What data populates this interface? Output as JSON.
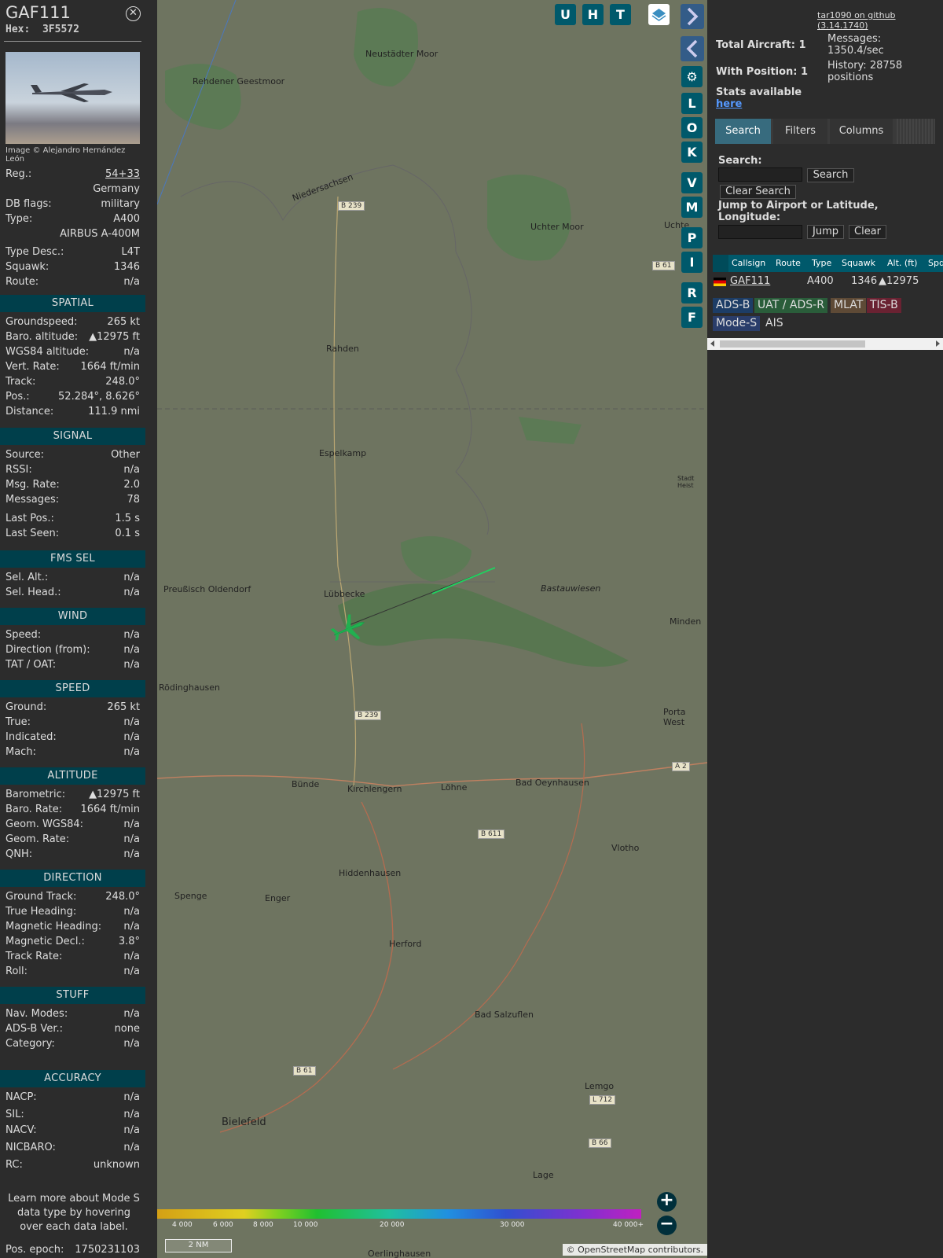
{
  "aircraft": {
    "callsign": "GAF111",
    "hex_label": "Hex:",
    "hex": "3F5572",
    "photo_credit": "Image © Alejandro Hernández León"
  },
  "details": [
    {
      "k": "Reg.:",
      "v": "54+33"
    },
    {
      "k": "",
      "v": "Germany"
    },
    {
      "k": "DB flags:",
      "v": "military"
    },
    {
      "k": "Type:",
      "v": "A400"
    },
    {
      "k": "",
      "v": "AIRBUS A-400M"
    },
    {
      "k": "Type Desc.:",
      "v": "L4T"
    },
    {
      "k": "Squawk:",
      "v": "1346"
    },
    {
      "k": "Route:",
      "v": "n/a"
    }
  ],
  "sections": {
    "spatial": {
      "title": "SPATIAL",
      "rows": [
        {
          "k": "Groundspeed:",
          "v": "265 kt"
        },
        {
          "k": "Baro. altitude:",
          "v": "▲12975 ft"
        },
        {
          "k": "WGS84 altitude:",
          "v": "n/a"
        },
        {
          "k": "Vert. Rate:",
          "v": "1664 ft/min"
        },
        {
          "k": "Track:",
          "v": "248.0°"
        },
        {
          "k": "Pos.:",
          "v": "52.284°, 8.626°"
        },
        {
          "k": "Distance:",
          "v": "111.9 nmi"
        }
      ]
    },
    "signal": {
      "title": "SIGNAL",
      "rows": [
        {
          "k": "Source:",
          "v": "Other"
        },
        {
          "k": "RSSI:",
          "v": "n/a"
        },
        {
          "k": "Msg. Rate:",
          "v": "2.0"
        },
        {
          "k": "Messages:",
          "v": "78"
        },
        {
          "k": "Last Pos.:",
          "v": "1.5 s"
        },
        {
          "k": "Last Seen:",
          "v": "0.1 s"
        }
      ]
    },
    "fms": {
      "title": "FMS SEL",
      "rows": [
        {
          "k": "Sel. Alt.:",
          "v": "n/a"
        },
        {
          "k": "Sel. Head.:",
          "v": "n/a"
        }
      ]
    },
    "wind": {
      "title": "WIND",
      "rows": [
        {
          "k": "Speed:",
          "v": "n/a"
        },
        {
          "k": "Direction (from):",
          "v": "n/a"
        },
        {
          "k": "TAT / OAT:",
          "v": "n/a"
        }
      ]
    },
    "speed": {
      "title": "SPEED",
      "rows": [
        {
          "k": "Ground:",
          "v": "265 kt"
        },
        {
          "k": "True:",
          "v": "n/a"
        },
        {
          "k": "Indicated:",
          "v": "n/a"
        },
        {
          "k": "Mach:",
          "v": "n/a"
        }
      ]
    },
    "altitude": {
      "title": "ALTITUDE",
      "rows": [
        {
          "k": "Barometric:",
          "v": "▲12975 ft"
        },
        {
          "k": "Baro. Rate:",
          "v": "1664 ft/min"
        },
        {
          "k": "Geom. WGS84:",
          "v": "n/a"
        },
        {
          "k": "Geom. Rate:",
          "v": "n/a"
        },
        {
          "k": "QNH:",
          "v": "n/a"
        }
      ]
    },
    "direction": {
      "title": "DIRECTION",
      "rows": [
        {
          "k": "Ground Track:",
          "v": "248.0°"
        },
        {
          "k": "True Heading:",
          "v": "n/a"
        },
        {
          "k": "Magnetic Heading:",
          "v": "n/a"
        },
        {
          "k": "Magnetic Decl.:",
          "v": "3.8°"
        },
        {
          "k": "Track Rate:",
          "v": "n/a"
        },
        {
          "k": "Roll:",
          "v": "n/a"
        }
      ]
    },
    "stuff": {
      "title": "STUFF",
      "rows": [
        {
          "k": "Nav. Modes:",
          "v": "n/a"
        },
        {
          "k": "ADS-B Ver.:",
          "v": "none"
        },
        {
          "k": "Category:",
          "v": "n/a"
        }
      ]
    },
    "accuracy": {
      "title": "ACCURACY",
      "rows": [
        {
          "k": "NACP:",
          "v": "n/a"
        },
        {
          "k": "SIL:",
          "v": "n/a"
        },
        {
          "k": "NACV:",
          "v": "n/a"
        },
        {
          "k": "NICBARO:",
          "v": "n/a"
        },
        {
          "k": "RC:",
          "v": "unknown"
        }
      ]
    }
  },
  "note": "Learn more about Mode S data type by hovering over each data label.",
  "pos_epoch": {
    "k": "Pos. epoch:",
    "v": "1750231103"
  },
  "map": {
    "buttons": [
      "U",
      "H",
      "T"
    ],
    "side_buttons": [
      "L",
      "O",
      "K",
      "V",
      "M",
      "P",
      "I",
      "R",
      "F"
    ],
    "towns": [
      "Neustädter Moor",
      "Rehdener Geestmoor",
      "Niedersachsen",
      "Uchter Moor",
      "Uchte",
      "Rahden",
      "Espelkamp",
      "Preußisch Oldendorf",
      "Lübbecke",
      "Bastauwiesen",
      "Minden",
      "Rödinghausen",
      "Porta West",
      "Bünde",
      "Kirchlengern",
      "Löhne",
      "Bad Oeynhausen",
      "Vlotho",
      "Hiddenhausen",
      "Spenge",
      "Enger",
      "Herford",
      "Bad Salzuflen",
      "Lemgo",
      "Bielefeld",
      "Lage",
      "Oerlinghausen",
      "Stadt Heist"
    ],
    "roads": [
      "B 239",
      "B 61",
      "B 239",
      "A 2",
      "B 611",
      "B 61",
      "L 712",
      "B 66"
    ],
    "scale_labels": [
      "4 000",
      "6 000",
      "8 000",
      "10 000",
      "20 000",
      "30 000",
      "40 000+"
    ],
    "scale_nm": "2 NM",
    "attribution": "© OpenStreetMap contributors.",
    "zoom_in": "+",
    "zoom_out": "−"
  },
  "right": {
    "github": "tar1090 on github (3.14.1740)",
    "total_aircraft": "Total Aircraft: 1",
    "with_position": "With Position: 1",
    "messages": "Messages: 1350.4/sec",
    "history": "History: 28758 positions",
    "stats": "Stats available",
    "stats_link": "here",
    "tabs": [
      "Search",
      "Filters",
      "Columns"
    ],
    "search_label": "Search:",
    "search_btn": "Search",
    "clear_search_btn": "Clear Search",
    "jump_label": "Jump to Airport or Latitude, Longitude:",
    "jump_btn": "Jump",
    "clear_btn": "Clear",
    "columns": [
      "Callsign",
      "Route",
      "Type",
      "Squawk",
      "Alt. (ft)",
      "Spd"
    ],
    "row": {
      "callsign": "GAF111",
      "route": "",
      "type": "A400",
      "squawk": "1346",
      "alt": "▲12975"
    },
    "legend": [
      "ADS-B",
      "UAT / ADS-R",
      "MLAT",
      "TIS-B",
      "Mode-S",
      "AIS"
    ]
  },
  "colors": {
    "section": "#003f4b",
    "accent": "#00596b",
    "tab_active": "#376b7e",
    "track": "#22d060"
  }
}
